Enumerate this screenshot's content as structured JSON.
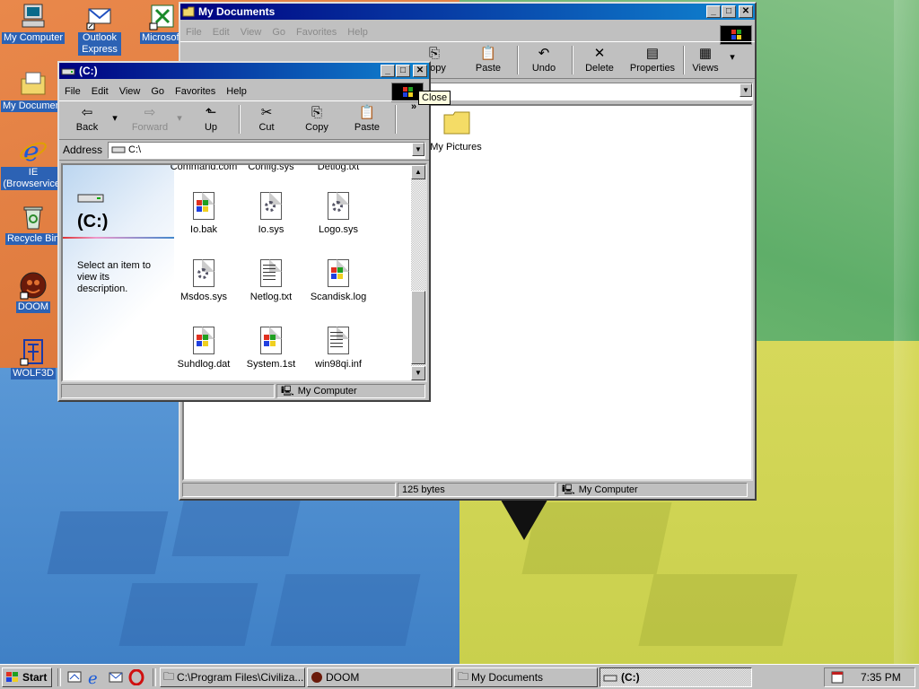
{
  "desktop": {
    "icons": [
      {
        "label": "My Computer"
      },
      {
        "label": "Outlook Express"
      },
      {
        "label": "Microsoft Excel"
      },
      {
        "label": "My Documents"
      },
      {
        "label": "IE (Browservice)"
      },
      {
        "label": "Recycle Bin"
      },
      {
        "label": "DOOM"
      },
      {
        "label": "WOLF3D"
      }
    ]
  },
  "mydocs": {
    "title": "My Documents",
    "menu": [
      "File",
      "Edit",
      "View",
      "Go",
      "Favorites",
      "Help"
    ],
    "toolbar": [
      "Copy",
      "Paste",
      "Undo",
      "Delete",
      "Properties",
      "Views"
    ],
    "files": [
      {
        "label": "My Pictures"
      }
    ],
    "status": {
      "size": "125 bytes",
      "zone": "My Computer"
    }
  },
  "cdrive": {
    "title": "(C:)",
    "menu": [
      "File",
      "Edit",
      "View",
      "Go",
      "Favorites",
      "Help"
    ],
    "toolbar": {
      "back": "Back",
      "forward": "Forward",
      "up": "Up",
      "cut": "Cut",
      "copy": "Copy",
      "paste": "Paste"
    },
    "address": {
      "label": "Address",
      "value": "C:\\"
    },
    "side": {
      "heading": "(C:)",
      "hint": "Select an item to view its description."
    },
    "files": [
      {
        "label": "Command.com"
      },
      {
        "label": "Config.sys"
      },
      {
        "label": "Detlog.txt"
      },
      {
        "label": "Io.bak"
      },
      {
        "label": "Io.sys"
      },
      {
        "label": "Logo.sys"
      },
      {
        "label": "Msdos.sys"
      },
      {
        "label": "Netlog.txt"
      },
      {
        "label": "Scandisk.log"
      },
      {
        "label": "Suhdlog.dat"
      },
      {
        "label": "System.1st"
      },
      {
        "label": "win98qi.inf"
      }
    ],
    "status": {
      "zone": "My Computer"
    },
    "tooltip": "Close"
  },
  "taskbar": {
    "start": "Start",
    "tasks": [
      {
        "label": "C:\\Program Files\\Civiliza..."
      },
      {
        "label": "DOOM"
      },
      {
        "label": "My Documents"
      },
      {
        "label": "(C:)"
      }
    ],
    "clock": "7:35 PM"
  },
  "colors": {
    "title_active": "#000080",
    "title_inactive": "#808080",
    "desktop_label": "#2c62b4"
  }
}
